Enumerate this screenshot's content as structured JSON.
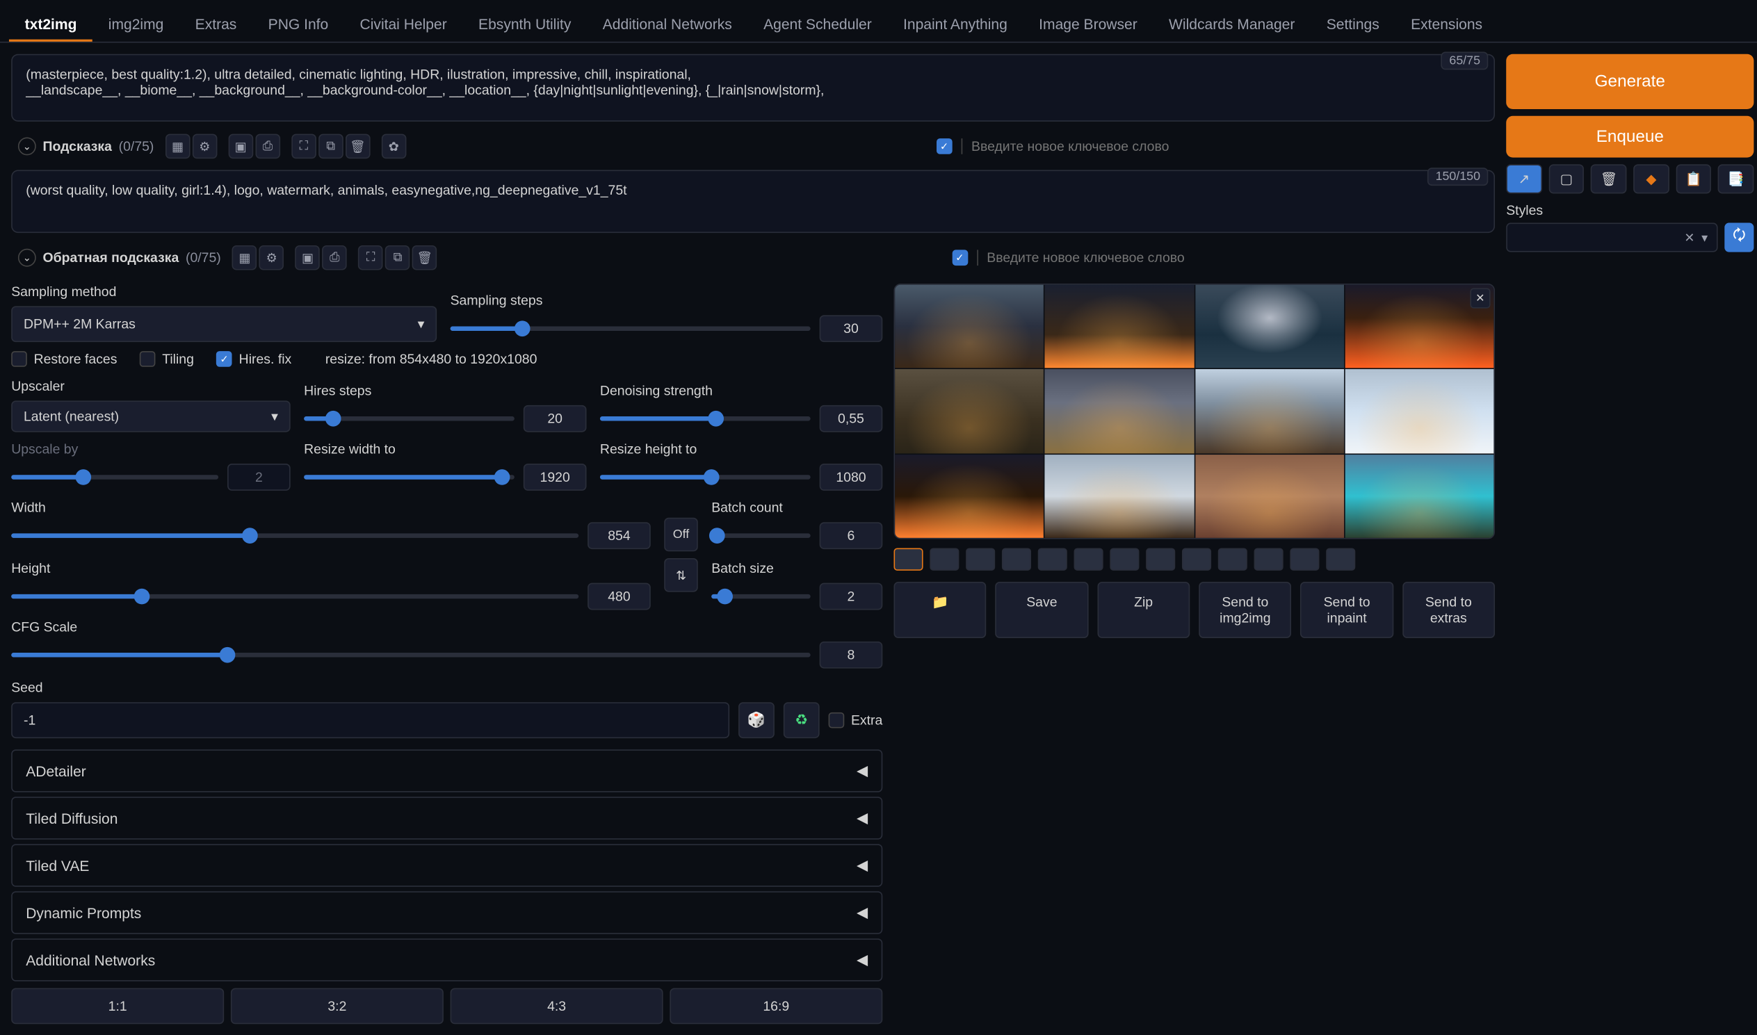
{
  "tabs": [
    "txt2img",
    "img2img",
    "Extras",
    "PNG Info",
    "Civitai Helper",
    "Ebsynth Utility",
    "Additional Networks",
    "Agent Scheduler",
    "Inpaint Anything",
    "Image Browser",
    "Wildcards Manager",
    "Settings",
    "Extensions"
  ],
  "activeTab": 0,
  "prompt": {
    "text": "(masterpiece, best quality:1.2), ultra detailed, cinematic lighting, HDR, ilustration, impressive, chill, inspirational,\n__landscape__, __biome__, __background__, __background-color__, __location__, {day|night|sunlight|evening}, {_|rain|snow|storm},",
    "counter": "65/75",
    "label": "Подсказка",
    "count": "(0/75)",
    "placeholder": "Введите новое ключевое слово"
  },
  "negprompt": {
    "text": "(worst quality, low quality, girl:1.4), logo, watermark, animals, easynegative,ng_deepnegative_v1_75t",
    "counter": "150/150",
    "label": "Обратная подсказка",
    "count": "(0/75)",
    "placeholder": "Введите новое ключевое слово"
  },
  "buttons": {
    "generate": "Generate",
    "enqueue": "Enqueue"
  },
  "styles": {
    "label": "Styles",
    "clear": "✕",
    "arrow": "▾"
  },
  "sampling": {
    "methodLabel": "Sampling method",
    "method": "DPM++ 2M Karras",
    "stepsLabel": "Sampling steps",
    "steps": "30"
  },
  "checks": {
    "restore": "Restore faces",
    "tiling": "Tiling",
    "hires": "Hires. fix"
  },
  "resizeText": "resize: from 854x480 to 1920x1080",
  "upscaler": {
    "label": "Upscaler",
    "value": "Latent (nearest)"
  },
  "hiresSteps": {
    "label": "Hires steps",
    "value": "20"
  },
  "denoise": {
    "label": "Denoising strength",
    "value": "0,55"
  },
  "upscaleBy": {
    "label": "Upscale by",
    "value": "2"
  },
  "resizeW": {
    "label": "Resize width to",
    "value": "1920"
  },
  "resizeH": {
    "label": "Resize height to",
    "value": "1080"
  },
  "width": {
    "label": "Width",
    "value": "854"
  },
  "height": {
    "label": "Height",
    "value": "480"
  },
  "off": "Off",
  "swap": "⇅",
  "batchCount": {
    "label": "Batch count",
    "value": "6"
  },
  "batchSize": {
    "label": "Batch size",
    "value": "2"
  },
  "cfg": {
    "label": "CFG Scale",
    "value": "8"
  },
  "seed": {
    "label": "Seed",
    "value": "-1",
    "extra": "Extra"
  },
  "accordions": [
    "ADetailer",
    "Tiled Diffusion",
    "Tiled VAE",
    "Dynamic Prompts",
    "Additional Networks"
  ],
  "ratios": [
    "1:1",
    "3:2",
    "4:3",
    "16:9"
  ],
  "actions": {
    "folder": "📁",
    "save": "Save",
    "zip": "Zip",
    "send2i": "Send to img2img",
    "sendInp": "Send to inpaint",
    "sendExt": "Send to extras"
  }
}
